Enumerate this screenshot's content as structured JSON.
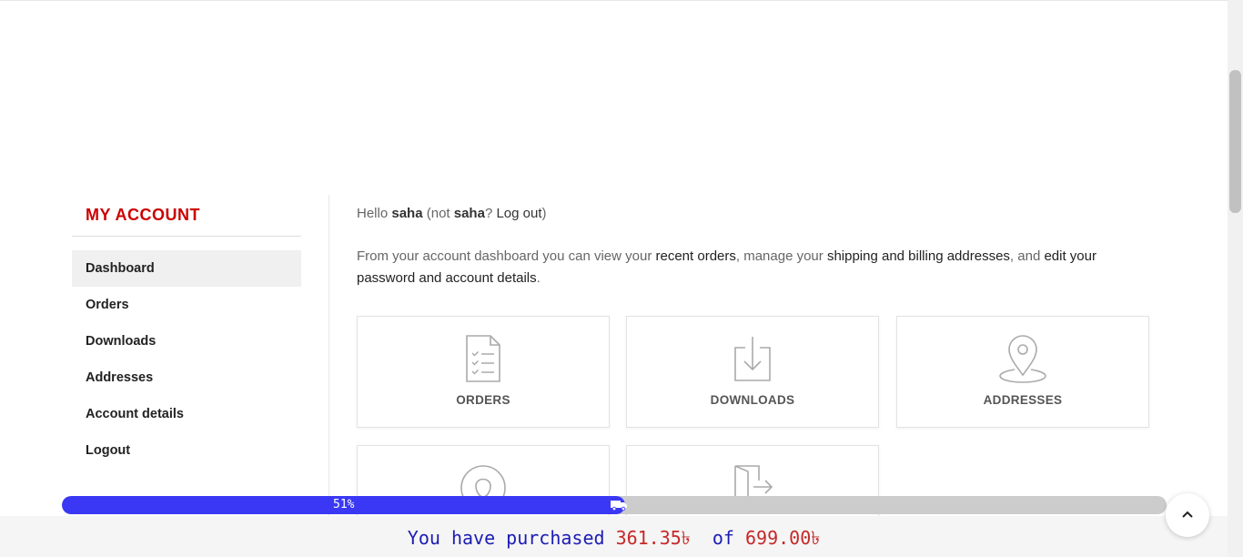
{
  "sidebar": {
    "title": "MY ACCOUNT",
    "items": [
      {
        "label": "Dashboard",
        "active": true
      },
      {
        "label": "Orders"
      },
      {
        "label": "Downloads"
      },
      {
        "label": "Addresses"
      },
      {
        "label": "Account details"
      },
      {
        "label": "Logout"
      }
    ]
  },
  "main": {
    "greeting": {
      "hello": "Hello ",
      "username": "saha",
      "not_open": " (not ",
      "username_again": "saha",
      "question": "? ",
      "logout_link": "Log out",
      "close": ")"
    },
    "intro": {
      "part1": "From your account dashboard you can view your ",
      "recent_orders_link": "recent orders",
      "part2": ", manage your ",
      "addresses_link": "shipping and billing addresses",
      "part3": ", and ",
      "edit_link": "edit your password and account details",
      "part4": "."
    },
    "cards": [
      {
        "label": "ORDERS",
        "icon": "orders-icon"
      },
      {
        "label": "DOWNLOADS",
        "icon": "downloads-icon"
      },
      {
        "label": "ADDRESSES",
        "icon": "addresses-icon"
      },
      {
        "label": "",
        "icon": "account-icon"
      },
      {
        "label": "",
        "icon": "logout-icon"
      }
    ]
  },
  "progress": {
    "percent": 51,
    "label": "51%",
    "icon": "truck-icon",
    "color": "#3a38f5"
  },
  "purchase": {
    "prefix": "You have purchased ",
    "amount": "361.35৳",
    "middle": "  of ",
    "target": "699.00৳"
  },
  "scroll_top": {
    "icon": "chevron-up-icon"
  }
}
